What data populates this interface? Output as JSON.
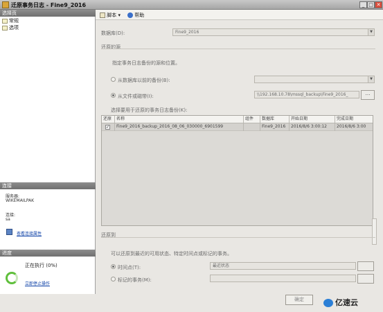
{
  "window": {
    "title": "迁原事务日志 - Fine9_2016"
  },
  "left_panel": {
    "select_page_header": "选择页",
    "pages": [
      "常规",
      "选项"
    ],
    "connection_header": "连接",
    "server_label": "服务器:",
    "server_value": "WIKEMAILPAK",
    "connect_label": "连接:",
    "connect_value": "sa",
    "view_conn_props": "查看连接属性",
    "progress_header": "进度",
    "status_text": "正在执行 (0%)",
    "stop_link": "立即停止操作"
  },
  "toolbar": {
    "script_label": "脚本",
    "help_label": "帮助"
  },
  "form": {
    "database_label": "数据库(D):",
    "database_value": "Fine9_2016",
    "source_group": "还原的源",
    "source_hint": "指定事务日志备份的源和位置。",
    "from_backup_label": "从数据库以前的备份(B):",
    "from_file_label": "从文件或磁带(I):",
    "file_path": "\\\\192.168.10.78\\mssql_backup\\Fine9_2016_",
    "select_backup_label": "选择要用于还原的事务日志备份(K):",
    "restore_to_group": "还原到",
    "restore_to_hint": "可以还原到最近的可用状态、特定时间点或标记的事务。",
    "point_in_time_label": "时间点(T):",
    "point_in_time_value": "最近状态",
    "marked_tx_label": "标记的事务(M):",
    "ok_button": "确定"
  },
  "grid": {
    "columns": [
      "还原",
      "名称",
      "组件",
      "数据库",
      "开始日期",
      "完成日期"
    ],
    "rows": [
      {
        "checked": true,
        "name": "Fine9_2016_backup_2016_08_06_030000_6901599",
        "component": "",
        "database": "Fine9_2016",
        "start": "2016/8/6 3:00:12",
        "finish": "2016/8/6 3:00"
      }
    ]
  },
  "watermark": {
    "text": "亿速云"
  },
  "colors": {
    "title_bar": "#a6a6a6",
    "panel_header": "#6f6f6f",
    "link": "#0b3fa6",
    "spinner": "#5fbf3b"
  }
}
